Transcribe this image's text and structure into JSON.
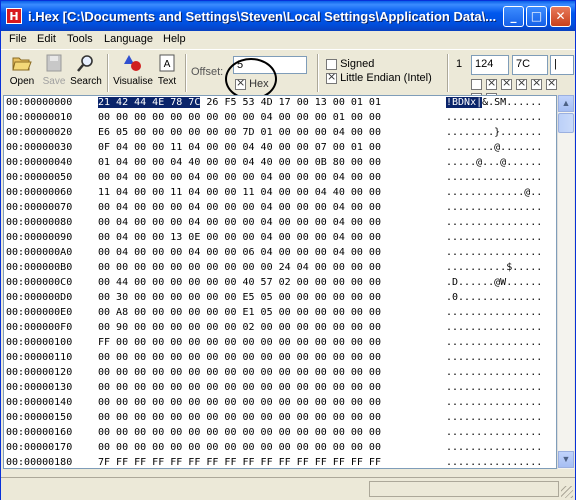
{
  "window": {
    "title": "i.Hex [C:\\Documents and Settings\\Steven\\Local Settings\\Application Data\\...",
    "app_icon_letter": "H",
    "buttons": {
      "minimize": "_",
      "maximize": "□",
      "close": "✕"
    }
  },
  "menu": [
    "File",
    "Edit",
    "Tools",
    "Language",
    "Help"
  ],
  "toolbar": {
    "open": "Open",
    "save": "Save",
    "search": "Search",
    "visualise": "Visualise",
    "text": "Text",
    "offset_label": "Offset:",
    "offset_value": "5",
    "hex_label": "Hex",
    "signed_label": "Signed",
    "endian_label": "Little Endian (Intel)",
    "number_label": "1",
    "dec_value": "124",
    "hex_value": "7C",
    "char_value": "|",
    "bits": [
      false,
      true,
      true,
      true,
      true,
      true,
      false,
      false
    ]
  },
  "hex": {
    "rows": [
      {
        "addr": "00:00000000",
        "bytes": "21 42 44 4E 78 7C 26 F5 53 4D 17 00 13 00 01 01",
        "ascii": "!BDNx|&.SM......"
      },
      {
        "addr": "00:00000010",
        "bytes": "00 00 00 00 00 00 00 00 00 04 00 00 00 01 00 00",
        "ascii": "................"
      },
      {
        "addr": "00:00000020",
        "bytes": "E6 05 00 00 00 00 00 00 7D 01 00 00 00 04 00 00",
        "ascii": "........}......."
      },
      {
        "addr": "00:00000030",
        "bytes": "0F 04 00 00 11 04 00 00 04 40 00 00 07 00 01 00",
        "ascii": "........@......."
      },
      {
        "addr": "00:00000040",
        "bytes": "01 04 00 00 04 40 00 00 04 40 00 00 0B 80 00 00",
        "ascii": ".....@...@......"
      },
      {
        "addr": "00:00000050",
        "bytes": "00 04 00 00 00 04 00 00 00 04 00 00 00 04 00 00",
        "ascii": "................"
      },
      {
        "addr": "00:00000060",
        "bytes": "11 04 00 00 11 04 00 00 11 04 00 00 04 40 00 00",
        "ascii": ".............@.."
      },
      {
        "addr": "00:00000070",
        "bytes": "00 04 00 00 00 04 00 00 00 04 00 00 00 04 00 00",
        "ascii": "................"
      },
      {
        "addr": "00:00000080",
        "bytes": "00 04 00 00 00 04 00 00 00 04 00 00 00 04 00 00",
        "ascii": "................"
      },
      {
        "addr": "00:00000090",
        "bytes": "00 04 00 00 13 0E 00 00 00 04 00 00 00 04 00 00",
        "ascii": "................"
      },
      {
        "addr": "00:000000A0",
        "bytes": "00 04 00 00 00 04 00 00 06 04 00 00 00 04 00 00",
        "ascii": "................"
      },
      {
        "addr": "00:000000B0",
        "bytes": "00 00 00 00 00 00 00 00 00 00 24 04 00 00 00 00",
        "ascii": "..........$....."
      },
      {
        "addr": "00:000000C0",
        "bytes": "00 44 00 00 00 00 00 00 40 57 02 00 00 00 00 00",
        "ascii": ".D......@W......"
      },
      {
        "addr": "00:000000D0",
        "bytes": "00 30 00 00 00 00 00 00 E5 05 00 00 00 00 00 00",
        "ascii": ".0.............."
      },
      {
        "addr": "00:000000E0",
        "bytes": "00 A8 00 00 00 00 00 00 E1 05 00 00 00 00 00 00",
        "ascii": "................"
      },
      {
        "addr": "00:000000F0",
        "bytes": "00 90 00 00 00 00 00 00 02 00 00 00 00 00 00 00",
        "ascii": "................"
      },
      {
        "addr": "00:00000100",
        "bytes": "FF 00 00 00 00 00 00 00 00 00 00 00 00 00 00 00",
        "ascii": "................"
      },
      {
        "addr": "00:00000110",
        "bytes": "00 00 00 00 00 00 00 00 00 00 00 00 00 00 00 00",
        "ascii": "................"
      },
      {
        "addr": "00:00000120",
        "bytes": "00 00 00 00 00 00 00 00 00 00 00 00 00 00 00 00",
        "ascii": "................"
      },
      {
        "addr": "00:00000130",
        "bytes": "00 00 00 00 00 00 00 00 00 00 00 00 00 00 00 00",
        "ascii": "................"
      },
      {
        "addr": "00:00000140",
        "bytes": "00 00 00 00 00 00 00 00 00 00 00 00 00 00 00 00",
        "ascii": "................"
      },
      {
        "addr": "00:00000150",
        "bytes": "00 00 00 00 00 00 00 00 00 00 00 00 00 00 00 00",
        "ascii": "................"
      },
      {
        "addr": "00:00000160",
        "bytes": "00 00 00 00 00 00 00 00 00 00 00 00 00 00 00 00",
        "ascii": "................"
      },
      {
        "addr": "00:00000170",
        "bytes": "00 00 00 00 00 00 00 00 00 00 00 00 00 00 00 00",
        "ascii": "................"
      },
      {
        "addr": "00:00000180",
        "bytes": "7F FF FF FF FF FF FF FF FF FF FF FF FF FF FF FF",
        "ascii": "................"
      }
    ],
    "selection_bytes": "21 42 44 4E 78 7C",
    "selection_ascii": "!BDNx|"
  },
  "colors": {
    "selection": "#0A246A",
    "titlebar": "#0058EE"
  }
}
